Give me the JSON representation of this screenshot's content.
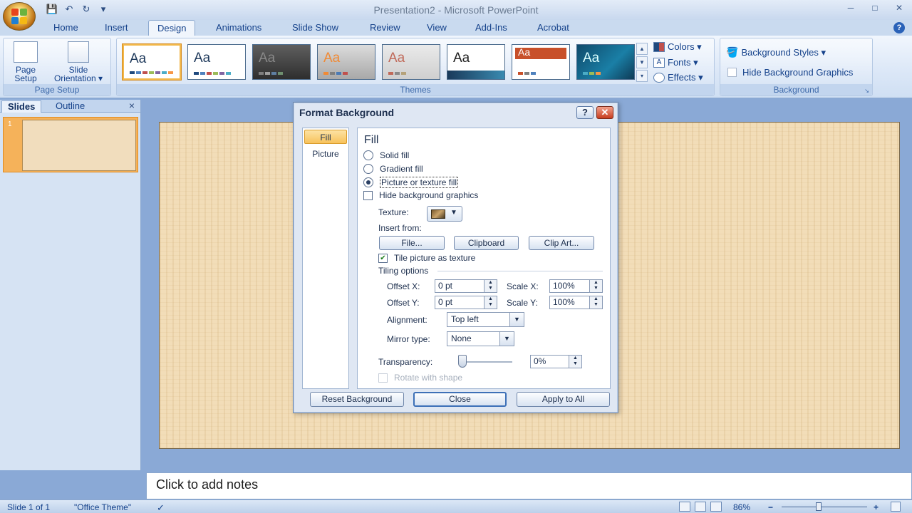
{
  "window": {
    "title": "Presentation2 - Microsoft PowerPoint",
    "controls": [
      "─",
      "□",
      "✕"
    ]
  },
  "qat": {
    "save": "💾",
    "undo": "↶",
    "redo": "↻",
    "more": "▾"
  },
  "tabs": [
    "Home",
    "Insert",
    "Design",
    "Animations",
    "Slide Show",
    "Review",
    "View",
    "Add-Ins",
    "Acrobat"
  ],
  "help_glyph": "?",
  "ribbon": {
    "page_setup": {
      "label": "Page Setup",
      "buttons": [
        {
          "label": "Page\nSetup"
        },
        {
          "label": "Slide\nOrientation ▾"
        }
      ]
    },
    "themes": {
      "label": "Themes",
      "sample_text": "Aa"
    },
    "theme_side": {
      "colors": "Colors ▾",
      "fonts": "Fonts ▾",
      "effects": "Effects ▾"
    },
    "background": {
      "label": "Background",
      "styles": "Background Styles ▾",
      "hide": "Hide Background Graphics"
    }
  },
  "slides_pane": {
    "tabs": [
      "Slides",
      "Outline"
    ],
    "close": "×",
    "slide_number": "1"
  },
  "notes": {
    "placeholder": "Click to add notes"
  },
  "status": {
    "slide": "Slide 1 of 1",
    "theme": "\"Office Theme\"",
    "zoom": "86%",
    "minus": "−",
    "plus": "+"
  },
  "dialog": {
    "title": "Format Background",
    "help": "?",
    "close": "✕",
    "nav": [
      "Fill",
      "Picture"
    ],
    "fill_heading": "Fill",
    "options": {
      "solid": "Solid fill",
      "gradient": "Gradient fill",
      "picture": "Picture or texture fill",
      "hide_graphics": "Hide background graphics"
    },
    "selected_option": "picture",
    "texture_label": "Texture:",
    "insert_from": "Insert from:",
    "buttons": {
      "file": "File...",
      "clipboard": "Clipboard",
      "clipart": "Clip Art..."
    },
    "tile_label": "Tile picture as texture",
    "tile_checked": true,
    "tiling_options": "Tiling options",
    "offset_x_label": "Offset X:",
    "offset_x": "0 pt",
    "offset_y_label": "Offset Y:",
    "offset_y": "0 pt",
    "scale_x_label": "Scale X:",
    "scale_x": "100%",
    "scale_y_label": "Scale Y:",
    "scale_y": "100%",
    "alignment_label": "Alignment:",
    "alignment": "Top left",
    "mirror_label": "Mirror type:",
    "mirror": "None",
    "transparency_label": "Transparency:",
    "transparency": "0%",
    "rotate_label": "Rotate with shape",
    "footer": {
      "reset": "Reset Background",
      "close": "Close",
      "apply_all": "Apply to All"
    }
  },
  "colors": {
    "ribbon_text": "#15428b",
    "selected_orange": "#f7c25b",
    "slide_texture": "#f2ddb8"
  }
}
